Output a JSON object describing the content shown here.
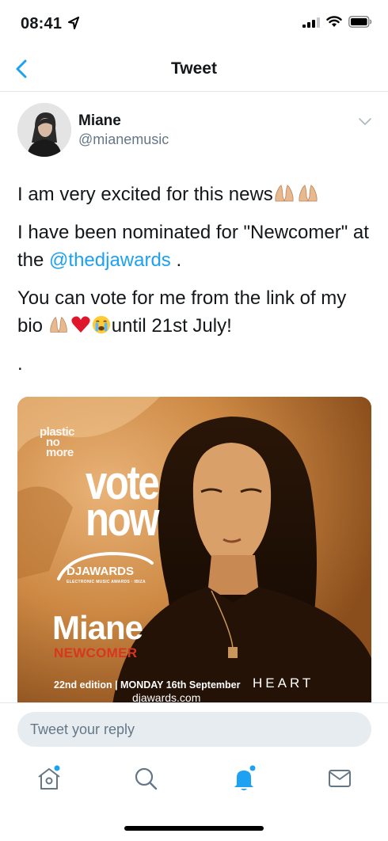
{
  "status_bar": {
    "time": "08:41"
  },
  "nav": {
    "title": "Tweet"
  },
  "tweet": {
    "author_name": "Miane",
    "author_handle": "@mianemusic",
    "line1_text": "I am very excited for this news",
    "line2_text": "I have been nominated for \"Newcomer\" at the ",
    "line2_mention": "@thedjawards",
    "line2_end": " .",
    "line3_before": "You can vote for me from the link of my bio ",
    "line3_after": "until 21st July!",
    "line4_text": "."
  },
  "media": {
    "brand_plastic": [
      "plastic",
      "no",
      "more"
    ],
    "vote_line1": "vote",
    "vote_line2": "now",
    "dj_awards": "DJAWARDS",
    "dj_awards_sub": "ELECTRONIC MUSIC AWARDS · IBIZA",
    "artist": "Miane",
    "category": "NEWCOMER",
    "edition": "22nd edition | MONDAY 16th September",
    "website": "djawards.com",
    "venue": "HEART"
  },
  "reply": {
    "placeholder": "Tweet your reply"
  },
  "tabs": [
    {
      "name": "home-icon"
    },
    {
      "name": "search-icon"
    },
    {
      "name": "notifications-icon"
    },
    {
      "name": "messages-icon"
    }
  ],
  "colors": {
    "accent": "#1da1f2",
    "text": "#14171a",
    "muted": "#657786",
    "reply_bg": "#e6ecf0"
  }
}
